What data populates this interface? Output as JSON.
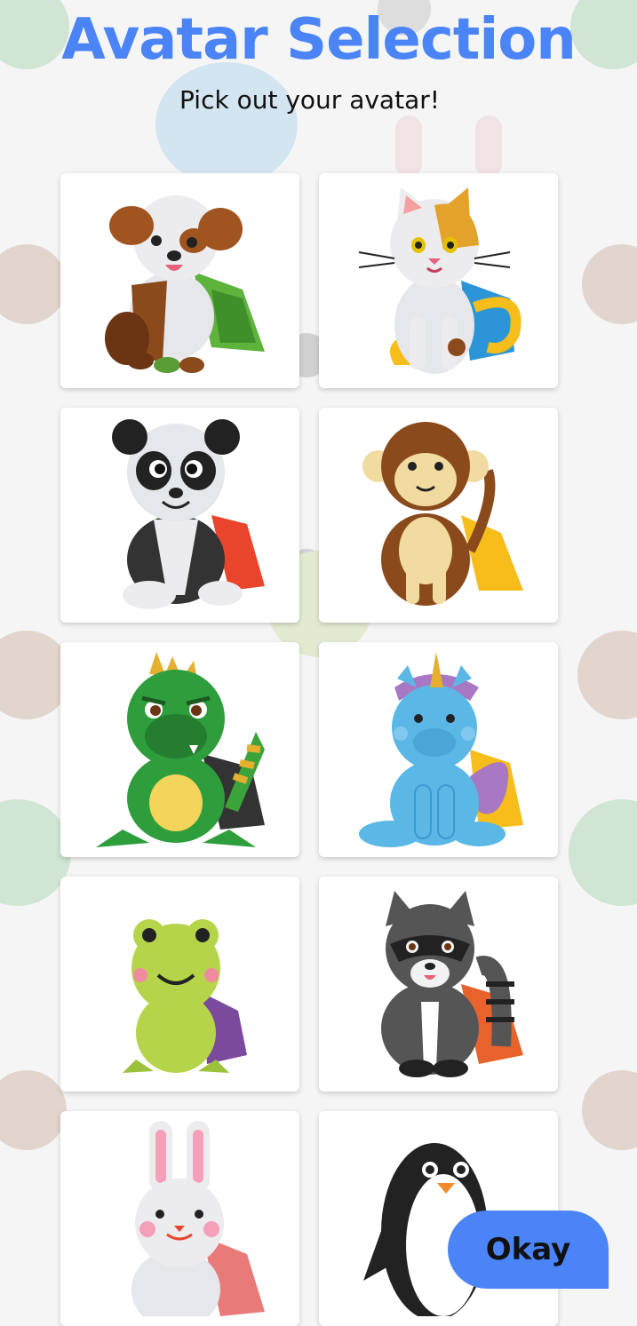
{
  "header": {
    "title": "Avatar Selection",
    "subtitle": "Pick out your avatar!"
  },
  "avatars": [
    {
      "name": "dog",
      "cape": "green"
    },
    {
      "name": "cat",
      "cape": "blue"
    },
    {
      "name": "panda",
      "cape": "red"
    },
    {
      "name": "monkey",
      "cape": "yellow"
    },
    {
      "name": "dragon",
      "cape": "black"
    },
    {
      "name": "unicorn",
      "cape": "yellow"
    },
    {
      "name": "frog",
      "cape": "purple"
    },
    {
      "name": "raccoon",
      "cape": "orange"
    },
    {
      "name": "bunny",
      "cape": "pink"
    },
    {
      "name": "penguin",
      "cape": "yellow"
    }
  ],
  "actions": {
    "okay_label": "Okay"
  },
  "colors": {
    "accent": "#4a84f7",
    "background": "#f5f5f5",
    "card": "#ffffff"
  }
}
